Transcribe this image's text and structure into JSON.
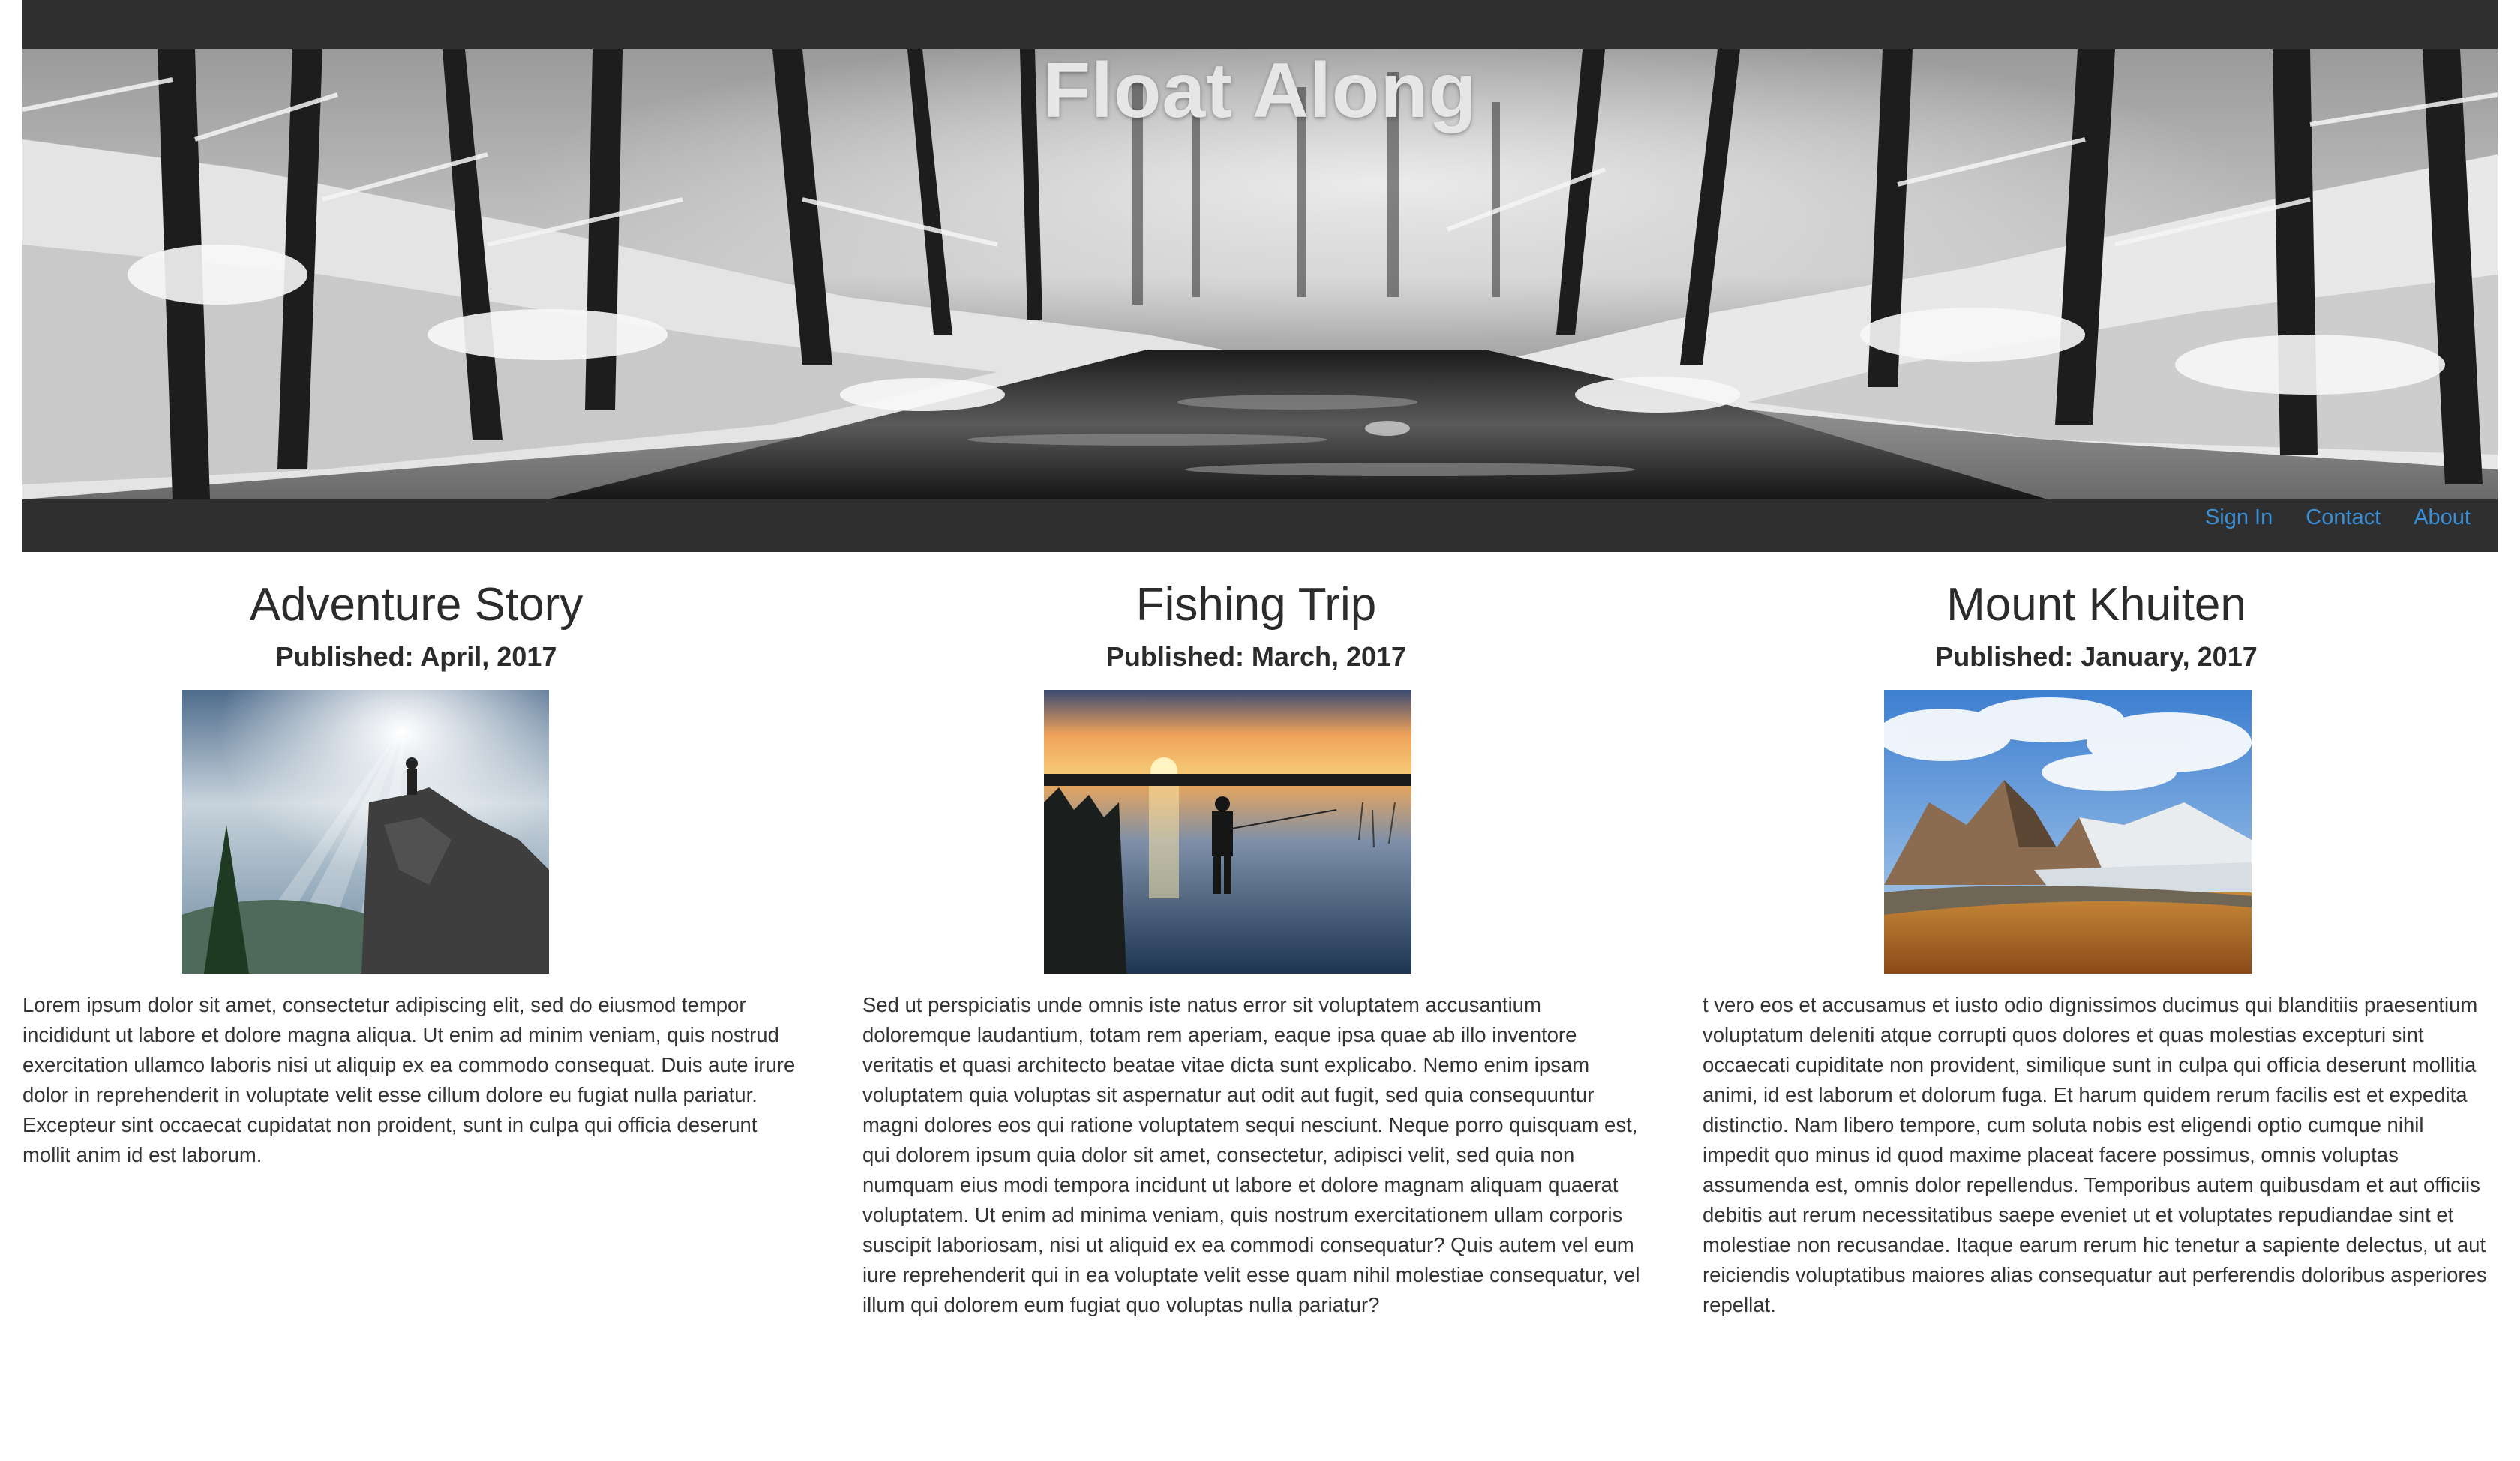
{
  "site": {
    "title": "Float Along",
    "nav": [
      "Sign In",
      "Contact",
      "About"
    ],
    "link_color": "#3a8fd6",
    "header_color": "#2f2f2f"
  },
  "articles": [
    {
      "title": "Adventure Story",
      "published": "Published: April, 2017",
      "image": "hiker-on-cliff-photo",
      "body": "Lorem ipsum dolor sit amet, consectetur adipiscing elit, sed do eiusmod tempor incididunt ut labore et dolore magna aliqua. Ut enim ad minim veniam, quis nostrud exercitation ullamco laboris nisi ut aliquip ex ea commodo consequat. Duis aute irure dolor in reprehenderit in voluptate velit esse cillum dolore eu fugiat nulla pariatur. Excepteur sint occaecat cupidatat non proident, sunt in culpa qui officia deserunt mollit anim id est laborum."
    },
    {
      "title": "Fishing Trip",
      "published": "Published: March, 2017",
      "image": "fisherman-sunset-photo",
      "body": "Sed ut perspiciatis unde omnis iste natus error sit voluptatem accusantium doloremque laudantium, totam rem aperiam, eaque ipsa quae ab illo inventore veritatis et quasi architecto beatae vitae dicta sunt explicabo. Nemo enim ipsam voluptatem quia voluptas sit aspernatur aut odit aut fugit, sed quia consequuntur magni dolores eos qui ratione voluptatem sequi nesciunt. Neque porro quisquam est, qui dolorem ipsum quia dolor sit amet, consectetur, adipisci velit, sed quia non numquam eius modi tempora incidunt ut labore et dolore magnam aliquam quaerat voluptatem. Ut enim ad minima veniam, quis nostrum exercitationem ullam corporis suscipit laboriosam, nisi ut aliquid ex ea commodi consequatur? Quis autem vel eum iure reprehenderit qui in ea voluptate velit esse quam nihil molestiae consequatur, vel illum qui dolorem eum fugiat quo voluptas nulla pariatur?"
    },
    {
      "title": "Mount Khuiten",
      "published": "Published: January, 2017",
      "image": "mountain-glacier-photo",
      "body": "t vero eos et accusamus et iusto odio dignissimos ducimus qui blanditiis praesentium voluptatum deleniti atque corrupti quos dolores et quas molestias excepturi sint occaecati cupiditate non provident, similique sunt in culpa qui officia deserunt mollitia animi, id est laborum et dolorum fuga. Et harum quidem rerum facilis est et expedita distinctio. Nam libero tempore, cum soluta nobis est eligendi optio cumque nihil impedit quo minus id quod maxime placeat facere possimus, omnis voluptas assumenda est, omnis dolor repellendus. Temporibus autem quibusdam et aut officiis debitis aut rerum necessitatibus saepe eveniet ut et voluptates repudiandae sint et molestiae non recusandae. Itaque earum rerum hic tenetur a sapiente delectus, ut aut reiciendis voluptatibus maiores alias consequatur aut perferendis doloribus asperiores repellat."
    }
  ]
}
